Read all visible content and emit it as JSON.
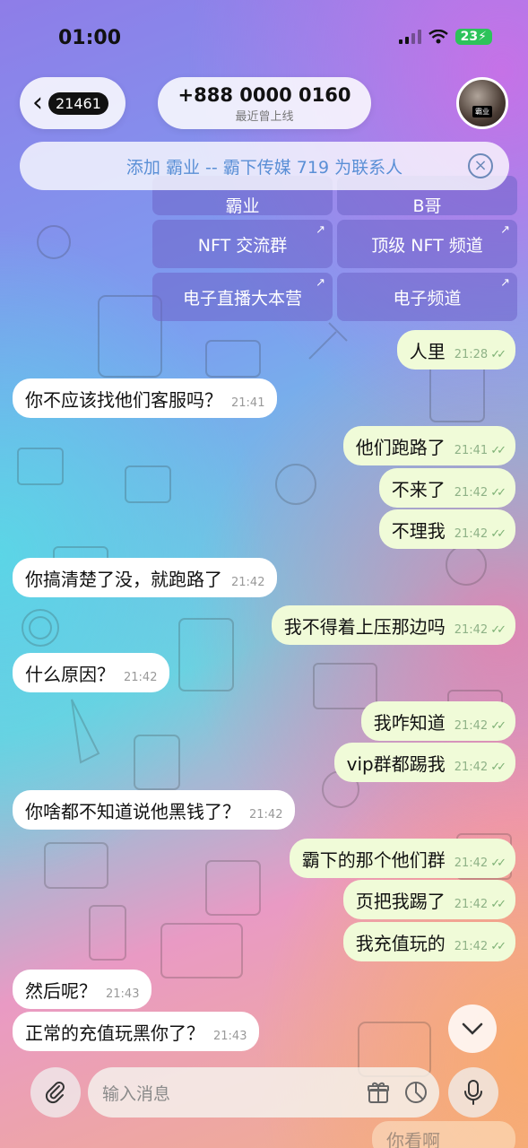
{
  "status_bar": {
    "time": "01:00",
    "battery": "23"
  },
  "header": {
    "unread_count": "21461",
    "title": "+888 0000 0160",
    "subtitle": "最近曾上线",
    "avatar_tag": "霸业"
  },
  "add_banner": {
    "text": "添加 霸业 -- 霸下传媒 719 为联系人"
  },
  "keyboard": {
    "top_left": "霸业",
    "top_right": "B哥",
    "buttons": [
      "NFT 交流群",
      "顶级 NFT 频道",
      "电子直播大本营",
      "电子频道"
    ]
  },
  "messages": [
    {
      "dir": "out",
      "text": "人里",
      "time": "21:28"
    },
    {
      "dir": "in",
      "text": "你不应该找他们客服吗？",
      "time": "21:41"
    },
    {
      "dir": "out",
      "text": "他们跑路了",
      "time": "21:41"
    },
    {
      "dir": "out",
      "text": "不来了",
      "time": "21:42"
    },
    {
      "dir": "out",
      "text": "不理我",
      "time": "21:42"
    },
    {
      "dir": "in",
      "text": "你搞清楚了没，就跑路了",
      "time": "21:42"
    },
    {
      "dir": "out",
      "text": "我不得着上压那边吗",
      "time": "21:42"
    },
    {
      "dir": "in",
      "text": "什么原因？",
      "time": "21:42"
    },
    {
      "dir": "out",
      "text": "我咋知道",
      "time": "21:42"
    },
    {
      "dir": "out",
      "text": "vip群都踢我",
      "time": "21:42"
    },
    {
      "dir": "in",
      "text": "你啥都不知道说他黑钱了？",
      "time": "21:42"
    },
    {
      "dir": "out",
      "text": "霸下的那个他们群",
      "time": "21:42"
    },
    {
      "dir": "out",
      "text": "页把我踢了",
      "time": "21:42"
    },
    {
      "dir": "out",
      "text": "我充值玩的",
      "time": "21:42"
    },
    {
      "dir": "in",
      "text": "然后呢？",
      "time": "21:43"
    },
    {
      "dir": "in",
      "text": "正常的充值玩黑你了？",
      "time": "21:43"
    }
  ],
  "input": {
    "placeholder": "输入消息"
  },
  "peek_text": "你看啊",
  "icons": {
    "back": "chevron-left-icon",
    "close": "close-circle-icon",
    "attach": "paperclip-icon",
    "gift": "gift-icon",
    "sticker": "sticker-icon",
    "mic": "microphone-icon",
    "scroll": "chevron-down-icon"
  }
}
